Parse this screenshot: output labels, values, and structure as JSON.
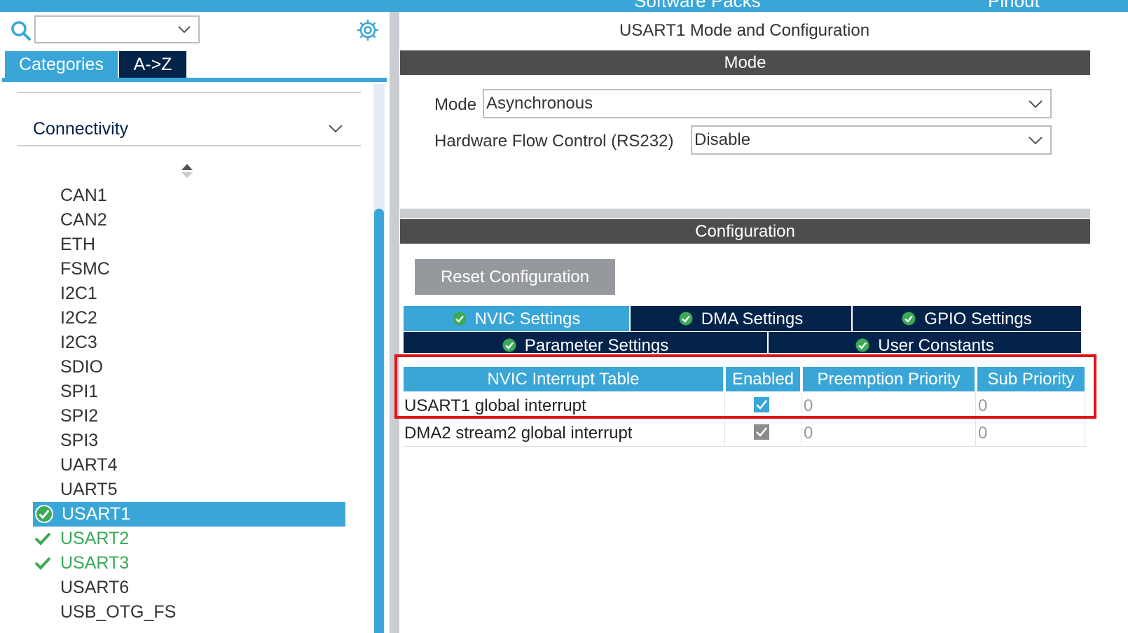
{
  "topbar": {
    "left_text": "Software Packs",
    "right_text": "Pinout"
  },
  "left_panel": {
    "search_value": "",
    "tabs": [
      {
        "label": "Categories"
      },
      {
        "label": "A->Z"
      }
    ],
    "category": "Connectivity",
    "items": [
      {
        "label": "CAN1",
        "state": "normal"
      },
      {
        "label": "CAN2",
        "state": "normal"
      },
      {
        "label": "ETH",
        "state": "normal"
      },
      {
        "label": "FSMC",
        "state": "normal"
      },
      {
        "label": "I2C1",
        "state": "normal"
      },
      {
        "label": "I2C2",
        "state": "normal"
      },
      {
        "label": "I2C3",
        "state": "normal"
      },
      {
        "label": "SDIO",
        "state": "normal"
      },
      {
        "label": "SPI1",
        "state": "normal"
      },
      {
        "label": "SPI2",
        "state": "normal"
      },
      {
        "label": "SPI3",
        "state": "normal"
      },
      {
        "label": "UART4",
        "state": "normal"
      },
      {
        "label": "UART5",
        "state": "normal"
      },
      {
        "label": "USART1",
        "state": "selected"
      },
      {
        "label": "USART2",
        "state": "configured"
      },
      {
        "label": "USART3",
        "state": "configured"
      },
      {
        "label": "USART6",
        "state": "normal"
      },
      {
        "label": "USB_OTG_FS",
        "state": "normal"
      }
    ]
  },
  "right_panel": {
    "title": "USART1 Mode and Configuration",
    "mode_section": {
      "header": "Mode",
      "mode_label": "Mode",
      "mode_value": "Asynchronous",
      "flow_label": "Hardware Flow Control (RS232)",
      "flow_value": "Disable"
    },
    "config_section": {
      "header": "Configuration",
      "reset_label": "Reset Configuration",
      "tabs_row1": [
        {
          "label": "NVIC Settings",
          "active": true
        },
        {
          "label": "DMA Settings",
          "active": false
        },
        {
          "label": "GPIO Settings",
          "active": false
        }
      ],
      "tabs_row2": [
        {
          "label": "Parameter Settings",
          "active": false
        },
        {
          "label": "User Constants",
          "active": false
        }
      ],
      "table": {
        "headers": [
          "NVIC Interrupt Table",
          "Enabled",
          "Preemption Priority",
          "Sub Priority"
        ],
        "rows": [
          {
            "name": "USART1 global interrupt",
            "enabled": true,
            "editable": true,
            "preemption": "0",
            "sub": "0"
          },
          {
            "name": "DMA2 stream2 global interrupt",
            "enabled": true,
            "editable": false,
            "preemption": "0",
            "sub": "0"
          }
        ]
      }
    }
  },
  "colors": {
    "accent": "#3aa6d8",
    "navy": "#03234b",
    "bar": "#4d4d4d",
    "ok_green": "#3aaa55",
    "highlight_red": "#e0161b"
  }
}
